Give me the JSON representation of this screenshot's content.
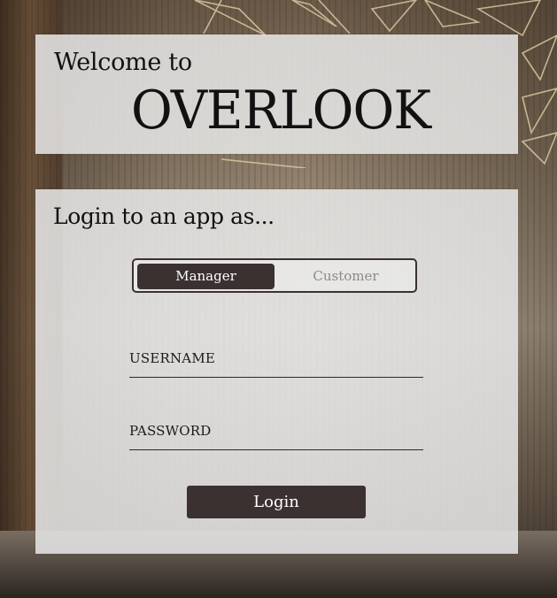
{
  "welcome": {
    "prefix": "Welcome to",
    "brand": "OVERLOOK"
  },
  "login": {
    "heading": "Login to an app as...",
    "roles": [
      {
        "label": "Manager",
        "selected": true
      },
      {
        "label": "Customer",
        "selected": false
      }
    ],
    "fields": {
      "username_label": "USERNAME",
      "username_value": "",
      "password_label": "PASSWORD",
      "password_value": ""
    },
    "submit_label": "Login"
  },
  "colors": {
    "accent": "#3b3131",
    "panel": "#e8e8e8",
    "inactive_text": "#8a8a8a"
  }
}
